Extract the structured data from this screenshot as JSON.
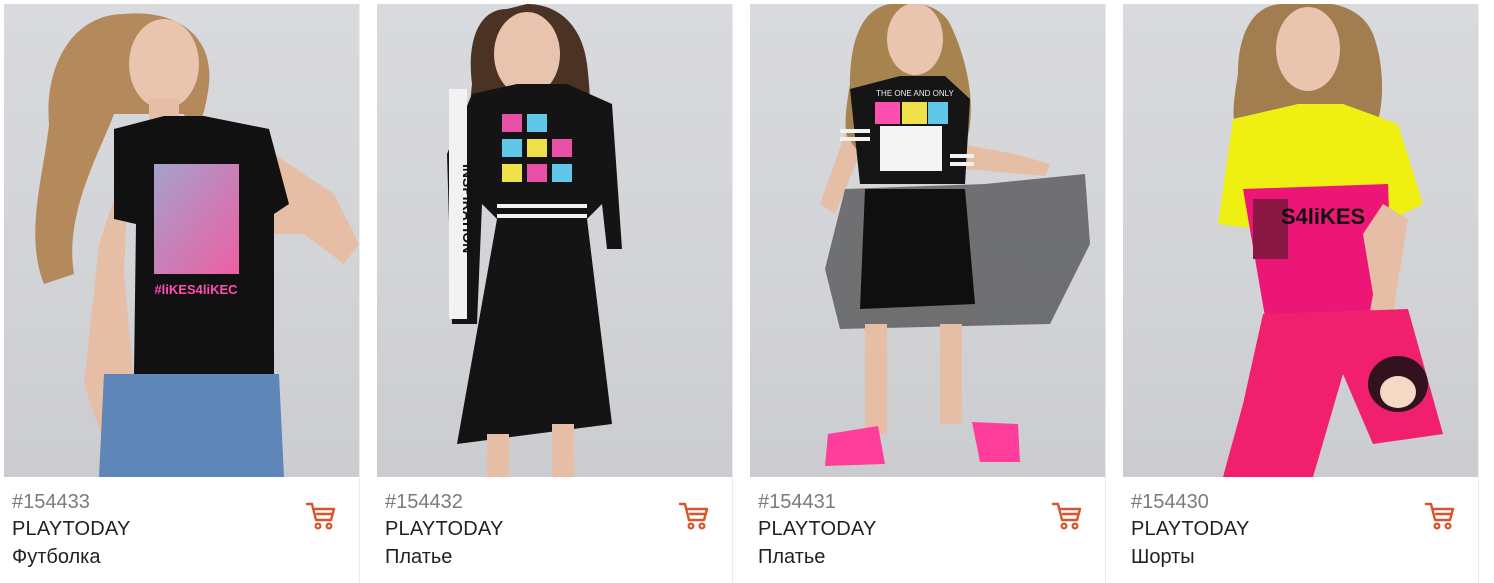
{
  "accent_color": "#d9542b",
  "products": [
    {
      "sku": "#154433",
      "brand": "PLAYTODAY",
      "name": "Футболка",
      "image_alt": "Футболка",
      "cart_icon": "shopping-cart-icon",
      "print_text": "#liKES4liKEC"
    },
    {
      "sku": "#154432",
      "brand": "PLAYTODAY",
      "name": "Платье",
      "image_alt": "Платье",
      "cart_icon": "shopping-cart-icon",
      "print_text": "INSPIRATION"
    },
    {
      "sku": "#154431",
      "brand": "PLAYTODAY",
      "name": "Платье",
      "image_alt": "Платье",
      "cart_icon": "shopping-cart-icon",
      "print_text": "THE ONE AND ONLY"
    },
    {
      "sku": "#154430",
      "brand": "PLAYTODAY",
      "name": "Шорты",
      "image_alt": "Шорты",
      "cart_icon": "shopping-cart-icon",
      "print_text": "S4liKES"
    }
  ]
}
